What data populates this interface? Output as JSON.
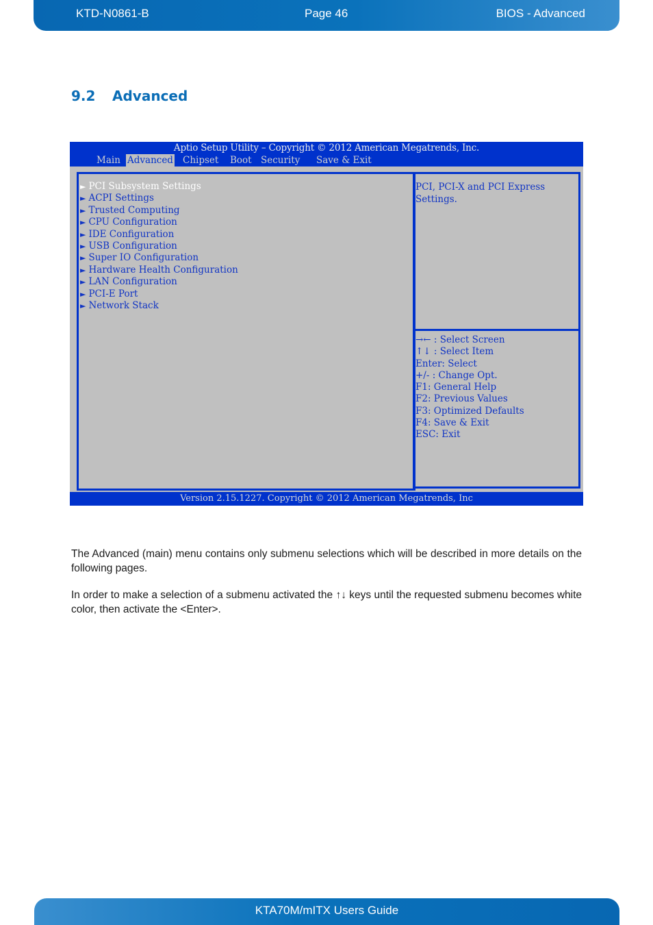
{
  "header": {
    "doc_id": "KTD-N0861-B",
    "page": "Page 46",
    "section": "BIOS  - Advanced"
  },
  "section": {
    "number": "9.2",
    "title": "Advanced"
  },
  "bios": {
    "title": "Aptio Setup Utility  –  Copyright © 2012 American Megatrends, Inc.",
    "tabs": [
      {
        "label": "Main",
        "active": false
      },
      {
        "label": "Advanced",
        "active": true
      },
      {
        "label": "Chipset",
        "active": false
      },
      {
        "label": "Boot",
        "active": false
      },
      {
        "label": "Security",
        "active": false
      },
      {
        "label": "Save & Exit",
        "active": false
      }
    ],
    "arrow_icon": "►",
    "menu_items": [
      {
        "label": "PCI Subsystem Settings",
        "selected": true
      },
      {
        "label": "ACPI Settings",
        "selected": false
      },
      {
        "label": "Trusted Computing",
        "selected": false
      },
      {
        "label": "CPU Configuration",
        "selected": false
      },
      {
        "label": "IDE Configuration",
        "selected": false
      },
      {
        "label": "USB Configuration",
        "selected": false
      },
      {
        "label": "Super IO Configuration",
        "selected": false
      },
      {
        "label": "Hardware Health Configuration",
        "selected": false
      },
      {
        "label": "LAN Configuration",
        "selected": false
      },
      {
        "label": "PCI-E Port",
        "selected": false
      },
      {
        "label": "Network Stack",
        "selected": false
      }
    ],
    "help_text": "PCI, PCI-X and PCI Express Settings.",
    "key_help": [
      "→← : Select Screen",
      "↑↓ : Select Item",
      "Enter: Select",
      "+/- : Change Opt.",
      "F1: General Help",
      "F2: Previous Values",
      "F3: Optimized Defaults",
      "F4: Save & Exit",
      "ESC: Exit"
    ],
    "version": "Version 2.15.1227. Copyright © 2012 American Megatrends, Inc",
    "colors": {
      "frame_blue": "#0032cc",
      "panel_gray": "#c0c0c0",
      "text_blue": "#1034c4",
      "selected_text": "#ffffff"
    }
  },
  "body": {
    "paragraph1": "The Advanced (main) menu contains only submenu selections which will be described in more details on the following pages.",
    "paragraph2": "In order to make a selection of a submenu activated the ↑↓ keys until the requested submenu becomes white color, then activate the <Enter>."
  },
  "footer": {
    "title": "KTA70M/mITX Users Guide"
  }
}
